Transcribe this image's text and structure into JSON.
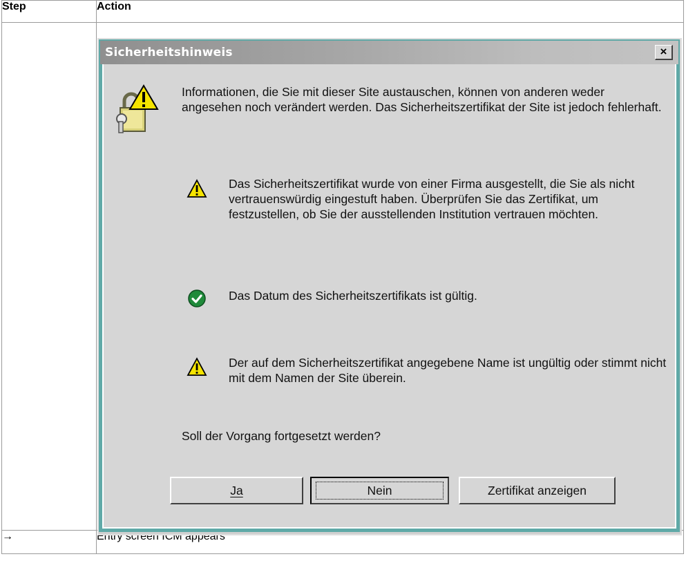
{
  "table": {
    "header_step": "Step",
    "header_action": "Action",
    "footer_step": "→",
    "footer_action": "Entry screen ICM appears"
  },
  "dialog": {
    "title": "Sicherheitshinweis",
    "close_label": "×",
    "main_message": "Informationen, die Sie mit dieser Site austauschen, können von anderen weder angesehen noch verändert werden. Das Sicherheitszertifikat der Site ist jedoch fehlerhaft.",
    "warning1": "Das Sicherheitszertifikat wurde von einer Firma ausgestellt, die Sie als nicht vertrauenswürdig eingestuft haben. Überprüfen Sie das Zertifikat, um festzustellen, ob Sie der ausstellenden Institution vertrauen möchten.",
    "ok1": "Das Datum des Sicherheitszertifikats ist gültig.",
    "warning2": "Der auf dem Sicherheitszertifikat angegebene Name ist ungültig oder stimmt nicht mit dem Namen der Site überein.",
    "question": "Soll der Vorgang fortgesetzt werden?",
    "buttons": {
      "ja": "Ja",
      "nein": "Nein",
      "zertifikat": "Zertifikat anzeigen"
    }
  },
  "colors": {
    "dialog_frame": "#5fa9a7",
    "dialog_body": "#d6d6d6",
    "warning_yellow": "#f5e400",
    "ok_green": "#1f8a3a"
  }
}
